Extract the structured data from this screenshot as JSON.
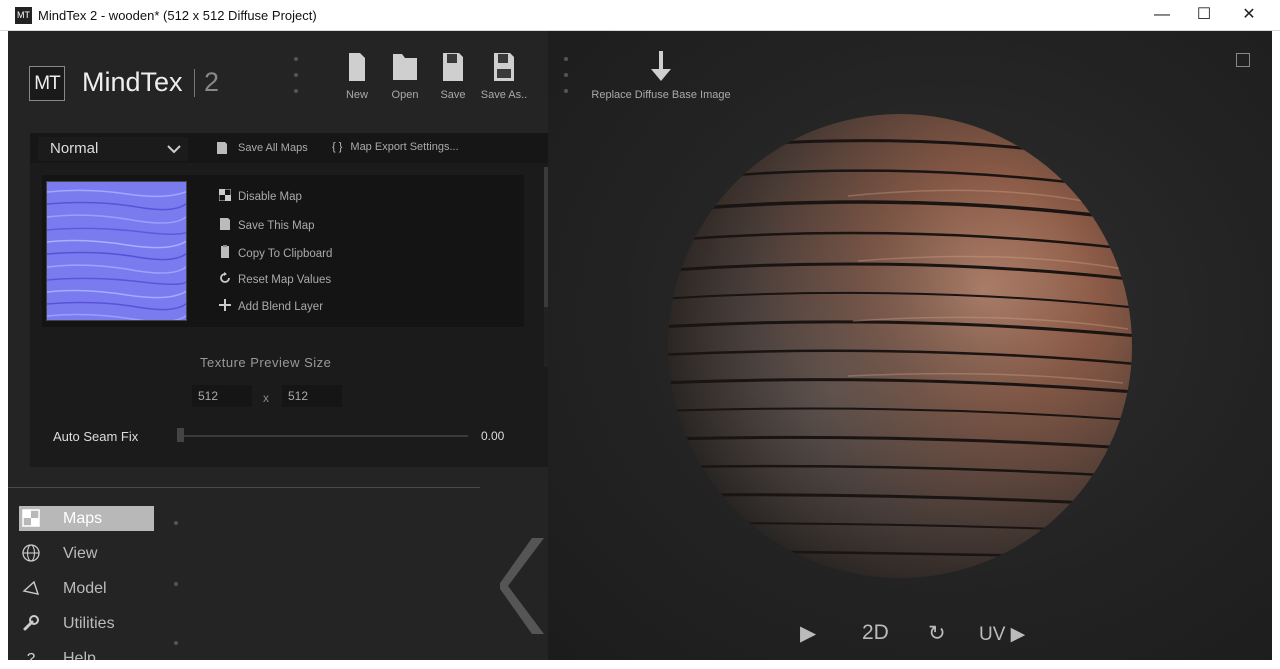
{
  "window": {
    "title": "MindTex 2 - wooden* (512 x 512 Diffuse Project)",
    "icon_text": "MT",
    "minimize_label": "—",
    "maximize_label": "☐",
    "close_label": "✕"
  },
  "brand": {
    "logo_text": "MT",
    "name": "MindTex",
    "version": "2"
  },
  "toolbar": {
    "new": "New",
    "open": "Open",
    "save": "Save",
    "save_as": "Save As..",
    "replace": "Replace Diffuse Base Image"
  },
  "panel": {
    "mode": "Normal",
    "save_all_maps": "Save All Maps",
    "export_settings": "Map Export Settings...",
    "export_icon_text": "{ }",
    "actions": {
      "disable_map": "Disable Map",
      "save_this_map": "Save This Map",
      "copy_to_clipboard": "Copy To Clipboard",
      "reset_map_values": "Reset Map Values",
      "add_blend_layer": "Add Blend Layer"
    },
    "texture_preview_size_label": "Texture Preview Size",
    "width": "512",
    "height": "512",
    "size_separator": "x",
    "auto_seam_fix_label": "Auto Seam Fix",
    "auto_seam_fix_value": "0.00"
  },
  "nav": {
    "maps": "Maps",
    "view": "View",
    "model": "Model",
    "utilities": "Utilities",
    "help": "Help"
  },
  "viewport_controls": {
    "play": "▶",
    "mode_2d": "2D",
    "reset": "↻",
    "uv": "UV ▶"
  },
  "colors": {
    "background": "#242424",
    "panel": "#1b1b1b",
    "normal_map_tint": "#7b7bf0",
    "nav_active": "#b8b8b8"
  }
}
